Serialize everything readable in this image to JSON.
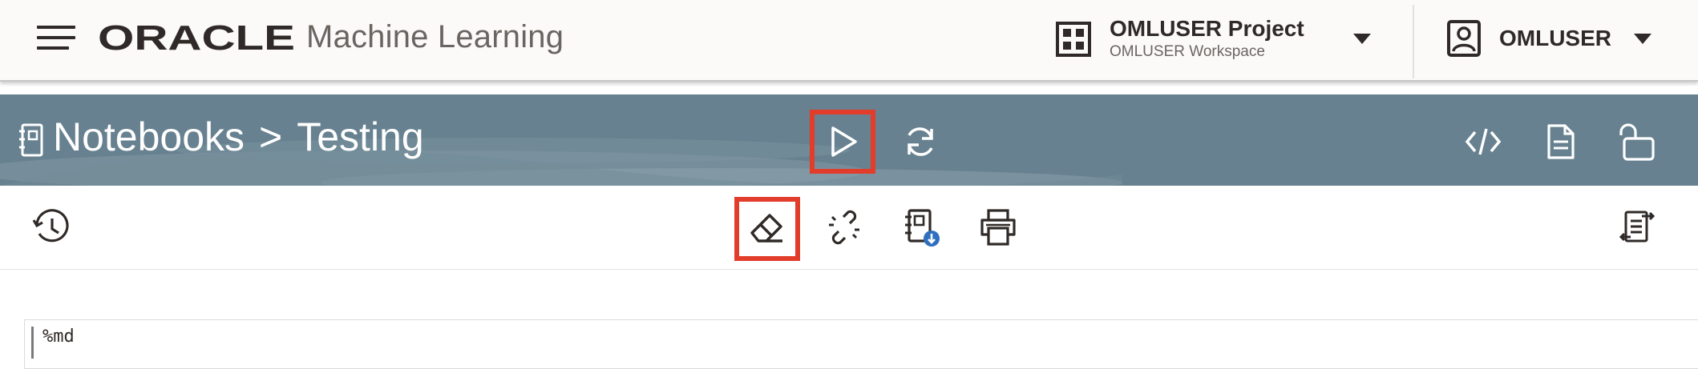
{
  "header": {
    "brand": "ORACLE",
    "product": "Machine Learning",
    "project_name": "OMLUSER Project",
    "workspace_name": "OMLUSER Workspace",
    "user_name": "OMLUSER",
    "icons": {
      "menu": "hamburger-menu-icon",
      "project": "project-grid-icon",
      "user": "user-badge-icon"
    }
  },
  "notebook": {
    "breadcrumb_root": "Notebooks",
    "separator": ">",
    "notebook_name": "Testing",
    "band_color": "#678190",
    "actions": [
      "run-all-icon",
      "refresh-icon",
      "code-view-icon",
      "document-icon",
      "unlock-icon"
    ]
  },
  "toolbar": {
    "left": [
      "history-icon"
    ],
    "center": [
      "eraser-clear-output-icon",
      "unlink-icon",
      "notebook-download-icon",
      "print-icon"
    ],
    "right": [
      "toggle-layout-icon"
    ]
  },
  "highlight_color": "#e23c2a",
  "paragraph": {
    "code": "%md"
  }
}
